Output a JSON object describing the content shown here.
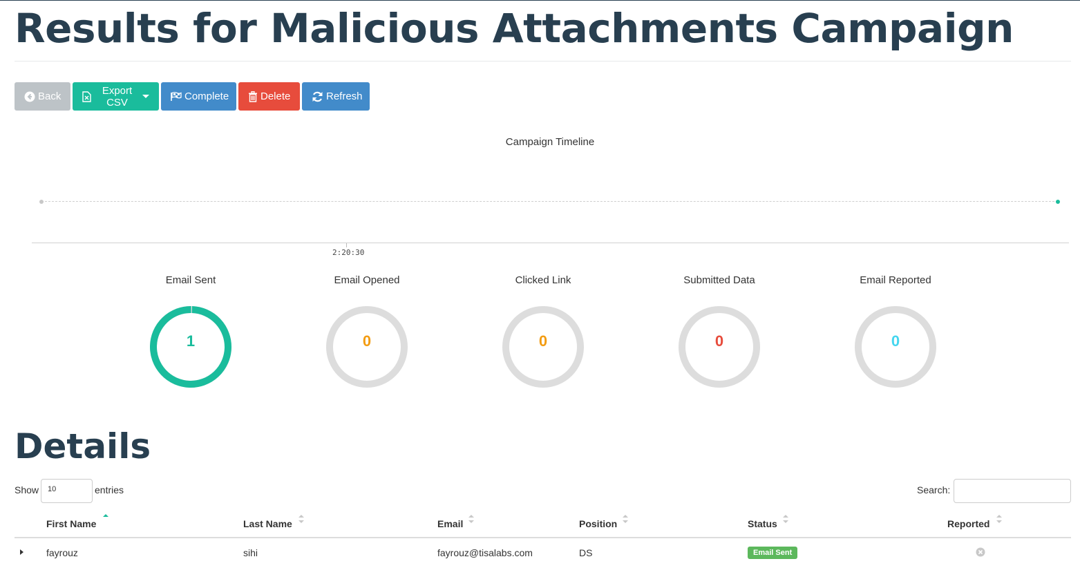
{
  "page": {
    "title": "Results for Malicious Attachments Campaign",
    "details_title": "Details"
  },
  "toolbar": {
    "back_label": "Back",
    "export_label": "Export CSV",
    "complete_label": "Complete",
    "delete_label": "Delete",
    "refresh_label": "Refresh"
  },
  "timeline": {
    "title": "Campaign Timeline",
    "tick_label": "2:20:30"
  },
  "stats": [
    {
      "label": "Email Sent",
      "value": "1",
      "fraction": 1.0,
      "color": "#1abc9c"
    },
    {
      "label": "Email Opened",
      "value": "0",
      "fraction": 0,
      "color": "#f39c12"
    },
    {
      "label": "Clicked Link",
      "value": "0",
      "fraction": 0,
      "color": "#f39c12"
    },
    {
      "label": "Submitted Data",
      "value": "0",
      "fraction": 0,
      "color": "#e74c3c"
    },
    {
      "label": "Email Reported",
      "value": "0",
      "fraction": 0,
      "color": "#45d6ef"
    }
  ],
  "table": {
    "show_label": "Show",
    "length_value": "10",
    "entries_label": "entries",
    "search_label": "Search:",
    "columns": [
      "First Name",
      "Last Name",
      "Email",
      "Position",
      "Status",
      "Reported"
    ],
    "rows": [
      {
        "first_name": "fayrouz",
        "last_name": "sihi",
        "email": "fayrouz@tisalabs.com",
        "position": "DS",
        "status": "Email Sent"
      }
    ]
  },
  "colors": {
    "heading": "#283f50",
    "back": "#bdc3c7",
    "export": "#1abc9c",
    "complete": "#428bca",
    "delete": "#e74c3c",
    "refresh": "#428bca",
    "ring_track": "#dddddd",
    "status_sent": "#5cb85c"
  }
}
